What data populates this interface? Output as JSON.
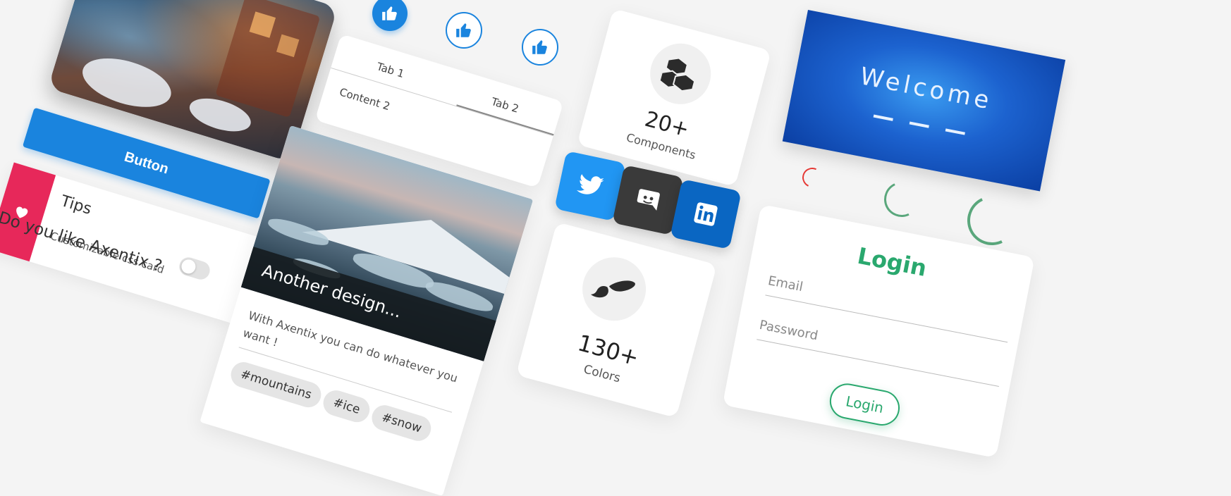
{
  "button": {
    "label": "Button"
  },
  "tips": {
    "title": "Tips",
    "text": "Customizable css card",
    "icon": "heart-icon",
    "accent": "#e7285a"
  },
  "question": {
    "label": "Do you like Axentix ?"
  },
  "likes": {
    "icon": "thumbs-up-icon",
    "color": "#1a84de"
  },
  "tabs": {
    "tab1": "Tab 1",
    "tab2": "Tab 2",
    "content": "Content 2"
  },
  "design_card": {
    "overlay_title": "Another design...",
    "text": "With Axentix you can do whatever you want !",
    "tags": [
      "#mountains",
      "#ice",
      "#snow"
    ]
  },
  "stats": [
    {
      "icon": "cubes-icon",
      "value": "20+",
      "label": "Components"
    },
    {
      "icon": "paintbrush-icon",
      "value": "130+",
      "label": "Colors"
    }
  ],
  "social": [
    {
      "icon": "twitter-icon",
      "color": "#2196f3"
    },
    {
      "icon": "discord-icon",
      "color": "#3a3a3a"
    },
    {
      "icon": "linkedin-icon",
      "color": "#0a66c2"
    }
  ],
  "welcome": {
    "title": "Welcome"
  },
  "login": {
    "title": "Login",
    "email_placeholder": "Email",
    "password_placeholder": "Password",
    "submit_label": "Login",
    "accent": "#2aa86e"
  }
}
